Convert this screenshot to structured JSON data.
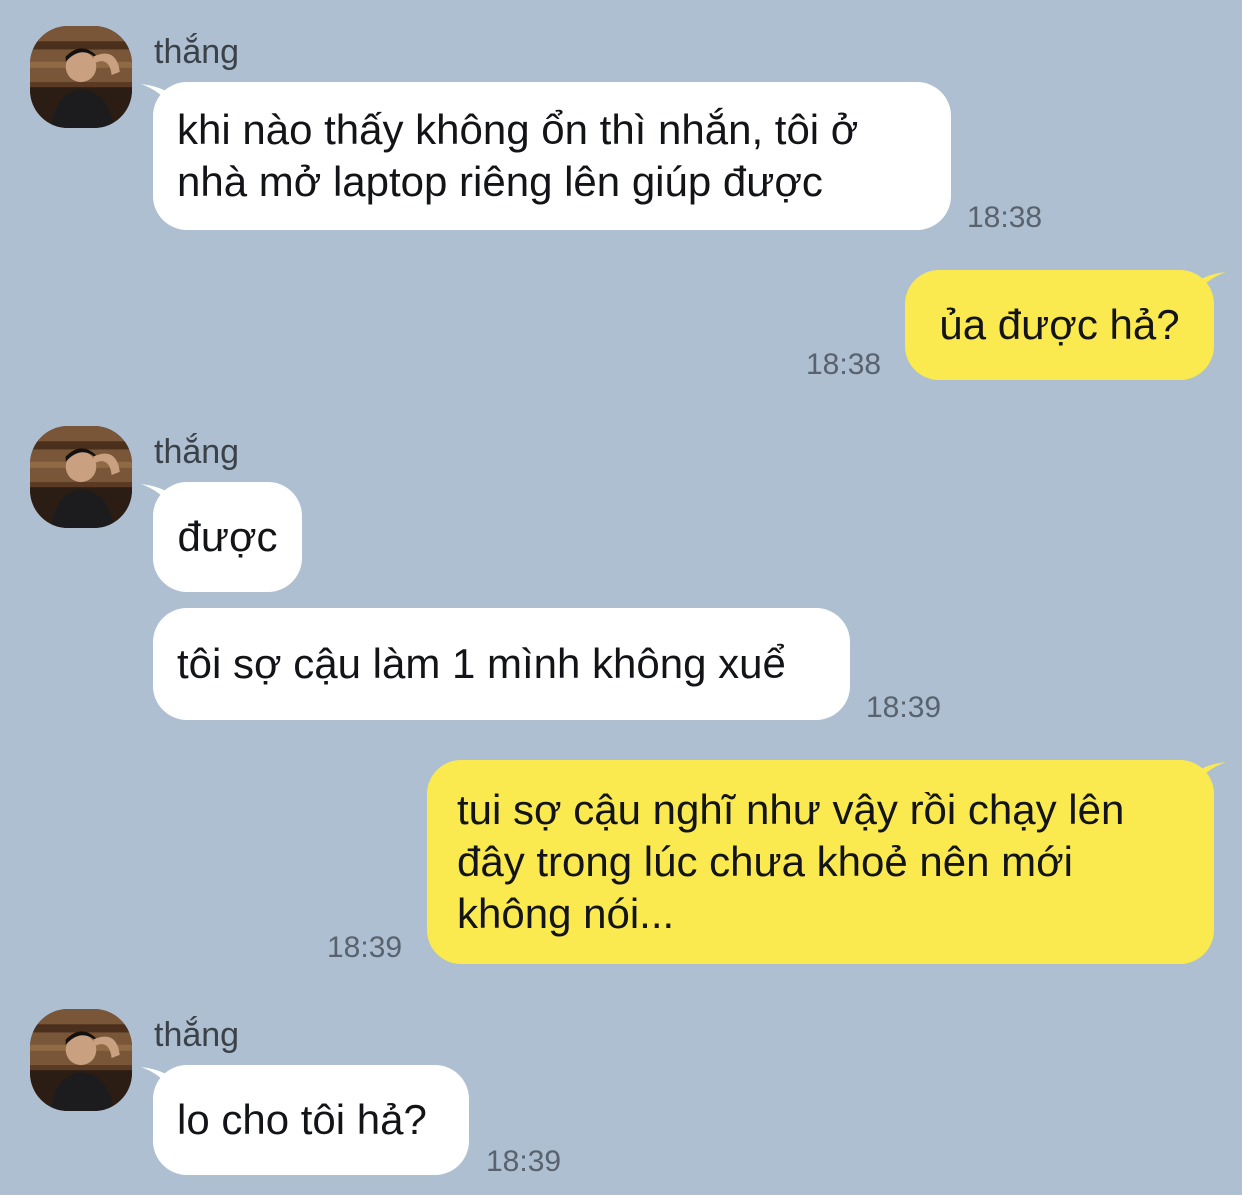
{
  "colors": {
    "background": "#adbfd0",
    "incoming_bubble": "#ffffff",
    "outgoing_bubble": "#fae94f",
    "text": "#121417",
    "timestamp": "#59626d"
  },
  "contact": {
    "name": "thắng",
    "avatar_icon": "user-photo-avatar"
  },
  "messages": [
    {
      "direction": "incoming",
      "lines": [
        "khi nào thấy không ổn thì nhắn, tôi ở",
        "nhà mở laptop riêng lên giúp được"
      ],
      "time": "18:38"
    },
    {
      "direction": "outgoing",
      "lines": [
        "ủa được hả?"
      ],
      "time": "18:38"
    },
    {
      "direction": "incoming",
      "lines": [
        "được"
      ],
      "time": ""
    },
    {
      "direction": "incoming",
      "lines": [
        "tôi sợ cậu làm 1 mình không xuể"
      ],
      "time": "18:39"
    },
    {
      "direction": "outgoing",
      "lines": [
        "tui sợ cậu nghĩ như vậy rồi chạy lên",
        "đây trong lúc chưa khoẻ nên mới",
        "không nói..."
      ],
      "time": "18:39"
    },
    {
      "direction": "incoming",
      "lines": [
        "lo cho tôi hả?"
      ],
      "time": "18:39"
    }
  ]
}
